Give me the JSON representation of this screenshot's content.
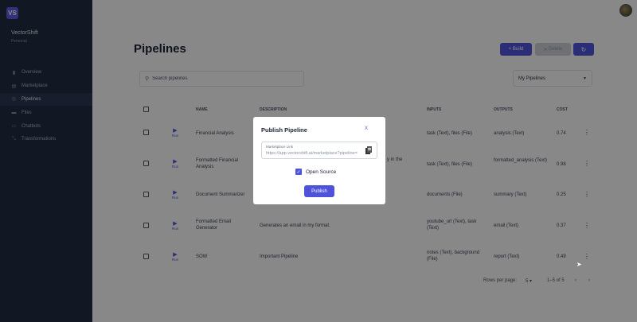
{
  "sidebar": {
    "logo": "VS",
    "org_name": "VectorShift",
    "org_sub": "Personal",
    "items": [
      {
        "label": "Overview",
        "icon": "bar-chart-icon",
        "glyph": "▮"
      },
      {
        "label": "Marketplace",
        "icon": "store-icon",
        "glyph": "▤"
      },
      {
        "label": "Pipelines",
        "icon": "pipeline-icon",
        "glyph": "◎",
        "active": true
      },
      {
        "label": "Files",
        "icon": "folder-icon",
        "glyph": "▬"
      },
      {
        "label": "Chatbots",
        "icon": "chat-icon",
        "glyph": "▭"
      },
      {
        "label": "Transformations",
        "icon": "transform-icon",
        "glyph": "⤡"
      }
    ]
  },
  "header": {
    "title": "Pipelines",
    "build_label": "Build",
    "delete_label": "Delete"
  },
  "search": {
    "placeholder": "Search pipelines"
  },
  "filter": {
    "selected": "My Pipelines"
  },
  "table": {
    "columns": {
      "name": "NAME",
      "description": "DESCRIPTION",
      "inputs": "INPUTS",
      "outputs": "OUTPUTS",
      "cost": "COST"
    },
    "run_label": "Run",
    "rows": [
      {
        "name": "Financial Analysis",
        "description": "",
        "inputs": "task (Text), files (File)",
        "outputs": "analysis (Text)",
        "cost": "0.74"
      },
      {
        "name": "Formatted Financial Analysis",
        "description": "y in the",
        "inputs": "task (Text), files (File)",
        "outputs": "formatted_analysis (Text)",
        "cost": "0.98"
      },
      {
        "name": "Document Summarizer",
        "description": "",
        "inputs": "documents (File)",
        "outputs": "summary (Text)",
        "cost": "0.25"
      },
      {
        "name": "Formatted Email Generator",
        "description": "Generates an email in my format.",
        "inputs": "youtube_url (Text), task (Text)",
        "outputs": "email (Text)",
        "cost": "0.37"
      },
      {
        "name": "SOW",
        "description": "Important Pipeline",
        "inputs": "notes (Text), background (File)",
        "outputs": "report (Text)",
        "cost": "0.49"
      }
    ]
  },
  "footer": {
    "rows_per_page_label": "Rows per page:",
    "rows_per_page": "5",
    "range": "1–5 of 5"
  },
  "modal": {
    "title": "Publish Pipeline",
    "close": "X",
    "link_label": "Marketplace Link",
    "link_value": "https://app.vectorshift.ai/marketplace?pipeline=",
    "open_source_label": "Open Source",
    "open_source_checked": true,
    "publish_label": "Publish"
  },
  "colors": {
    "accent": "#4f53d9",
    "sidebar": "#1f2a40"
  }
}
